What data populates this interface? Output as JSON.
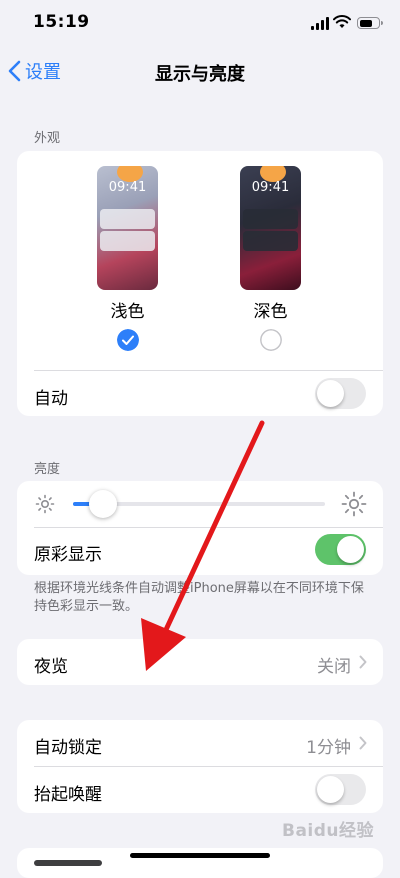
{
  "status": {
    "time": "15:19"
  },
  "nav": {
    "back_label": "设置",
    "title": "显示与亮度"
  },
  "appearance": {
    "header": "外观",
    "preview_time": "09:41",
    "light_label": "浅色",
    "dark_label": "深色",
    "selected": "light",
    "auto_label": "自动",
    "auto_on": false
  },
  "brightness": {
    "header": "亮度",
    "level": 0.08,
    "true_tone_label": "原彩显示",
    "true_tone_on": true,
    "footnote": "根据环境光线条件自动调整iPhone屏幕以在不同环境下保持色彩显示一致。"
  },
  "night_shift": {
    "label": "夜览",
    "value": "关闭"
  },
  "lock": {
    "auto_lock_label": "自动锁定",
    "auto_lock_value": "1分钟",
    "raise_to_wake_label": "抬起唤醒",
    "raise_to_wake_on": false
  },
  "watermark": "Baidu经验",
  "colors": {
    "accent": "#2d7ff9",
    "toggle_on": "#5ec36a",
    "arrow": "#e3181b"
  }
}
